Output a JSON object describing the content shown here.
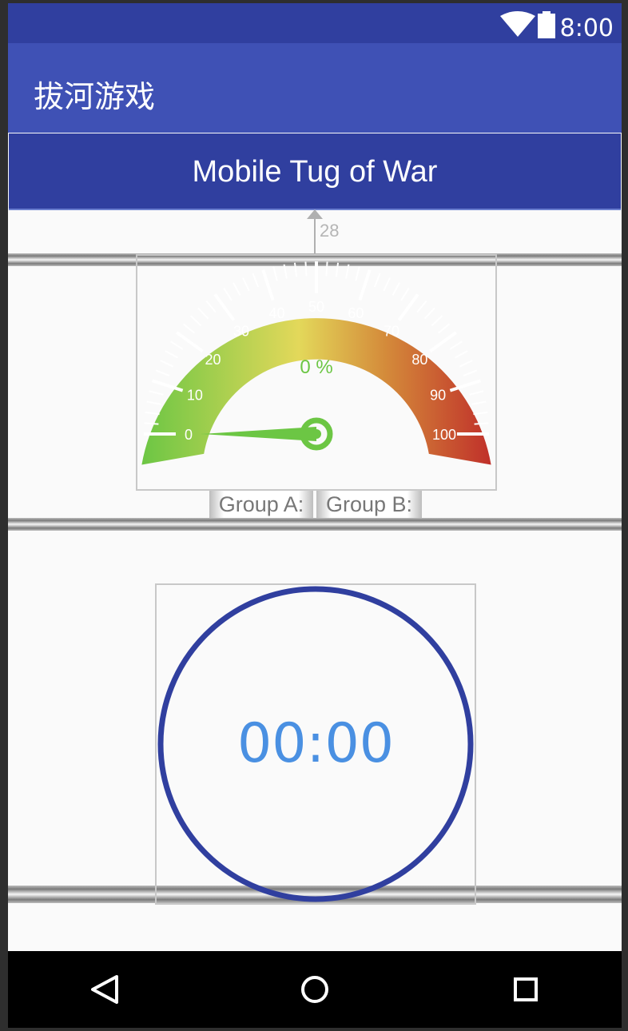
{
  "status_bar": {
    "time": "8:00",
    "icons": [
      "wifi-icon",
      "battery-icon"
    ]
  },
  "app_bar": {
    "title": "拔河游戏"
  },
  "banner": {
    "title": "Mobile Tug of War"
  },
  "pointer": {
    "value_label": "28"
  },
  "gauge": {
    "value": 0,
    "value_label": "0 %",
    "min": 0,
    "max": 100,
    "tick_labels": [
      "0",
      "10",
      "20",
      "30",
      "40",
      "50",
      "60",
      "70",
      "80",
      "90",
      "100"
    ],
    "colors": {
      "low": "#6cc644",
      "mid": "#e3d85a",
      "high": "#c0302a",
      "needle": "#6cc644"
    }
  },
  "groups": {
    "a_label": "Group A:",
    "b_label": "Group B:"
  },
  "timer": {
    "value": "00:00",
    "ring_color": "#303f9f",
    "text_color": "#4a90e2"
  },
  "nav": {
    "icons": [
      "back-icon",
      "home-icon",
      "recents-icon"
    ]
  }
}
